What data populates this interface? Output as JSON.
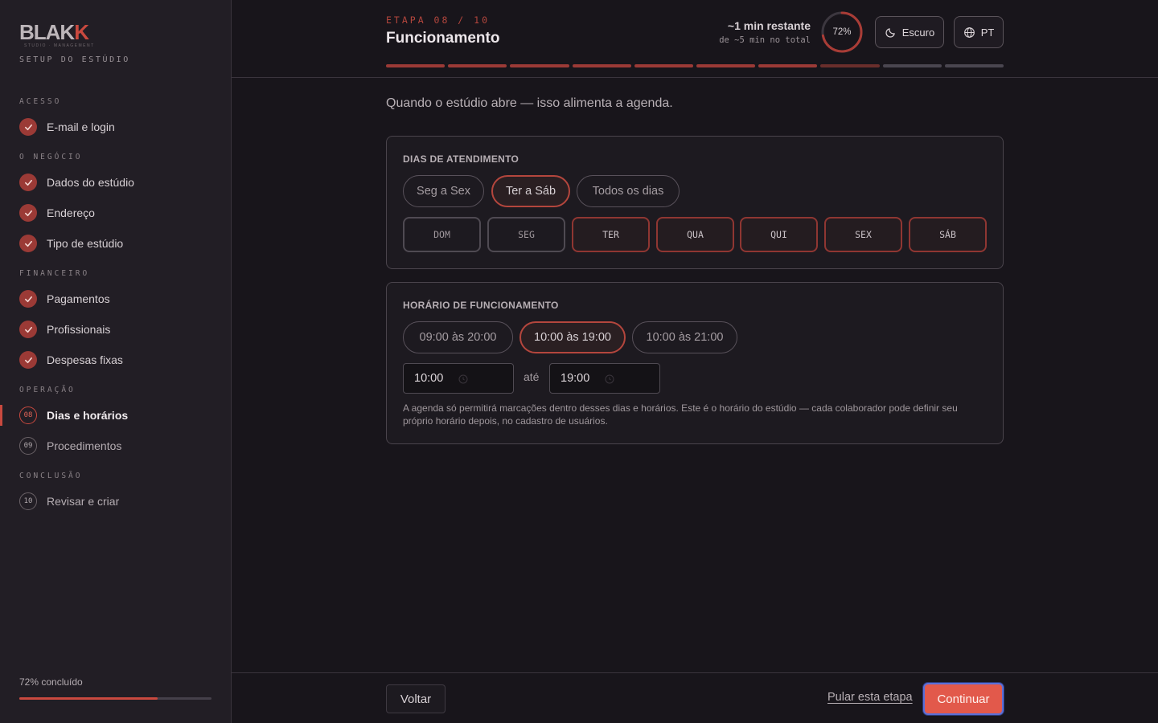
{
  "brand": {
    "logo_text": "BLAK",
    "logo_accent": "K",
    "logo_tagline": "STUDIO · MANAGEMENT",
    "setup_title": "SETUP DO ESTÚDIO"
  },
  "sidebar": {
    "sections": [
      {
        "label": "ACESSO"
      },
      {
        "label": "O NEGÓCIO"
      },
      {
        "label": "FINANCEIRO"
      },
      {
        "label": "OPERAÇÃO"
      },
      {
        "label": "CONCLUSÃO"
      }
    ],
    "items": [
      {
        "label": "E-mail e login",
        "status": "done"
      },
      {
        "label": "Dados do estúdio",
        "status": "done"
      },
      {
        "label": "Endereço",
        "status": "done"
      },
      {
        "label": "Tipo de estúdio",
        "status": "done"
      },
      {
        "label": "Pagamentos",
        "status": "done"
      },
      {
        "label": "Profissionais",
        "status": "done"
      },
      {
        "label": "Despesas fixas",
        "status": "done"
      },
      {
        "label": "Dias e horários",
        "status": "current",
        "number": "08"
      },
      {
        "label": "Procedimentos",
        "status": "pending",
        "number": "09"
      },
      {
        "label": "Revisar e criar",
        "status": "pending",
        "number": "10"
      }
    ],
    "progress_label": "72% concluído",
    "progress_value": 0.72
  },
  "header": {
    "step_label": "ETAPA 08 / 10",
    "title": "Funcionamento",
    "time_remaining": "~1 min restante",
    "time_total": "de ~5 min no total",
    "progress_percent": "72%",
    "progress_value": 0.72,
    "theme_button": "Escuro",
    "language_button": "PT",
    "segments": [
      "done",
      "done",
      "done",
      "done",
      "done",
      "done",
      "done",
      "current",
      "pending",
      "pending"
    ]
  },
  "main": {
    "intro": "Quando o estúdio abre — isso alimenta a agenda.",
    "days_card": {
      "title": "DIAS DE ATENDIMENTO",
      "presets": [
        {
          "label": "Seg a Sex",
          "selected": false
        },
        {
          "label": "Ter a Sáb",
          "selected": true
        },
        {
          "label": "Todos os dias",
          "selected": false
        }
      ],
      "days": [
        {
          "label": "DOM",
          "selected": false
        },
        {
          "label": "SEG",
          "selected": false
        },
        {
          "label": "TER",
          "selected": true
        },
        {
          "label": "QUA",
          "selected": true
        },
        {
          "label": "QUI",
          "selected": true
        },
        {
          "label": "SEX",
          "selected": true
        },
        {
          "label": "SÁB",
          "selected": true
        }
      ]
    },
    "hours_card": {
      "title": "HORÁRIO DE FUNCIONAMENTO",
      "presets": [
        {
          "label": "09:00 às 20:00",
          "selected": false
        },
        {
          "label": "10:00 às 19:00",
          "selected": true
        },
        {
          "label": "10:00 às 21:00",
          "selected": false
        }
      ],
      "start_time": "10:00",
      "separator": "até",
      "end_time": "19:00",
      "note": "A agenda só permitirá marcações dentro desses dias e horários. Este é o horário do estúdio — cada colaborador pode definir seu próprio horário depois, no cadastro de usuários."
    }
  },
  "footer": {
    "back_label": "Voltar",
    "skip_label": "Pular esta etapa",
    "continue_label": "Continuar"
  },
  "colors": {
    "accent": "#c9493f",
    "accent_button": "#e2594b",
    "background": "#18151b",
    "sidebar": "#221e25"
  }
}
